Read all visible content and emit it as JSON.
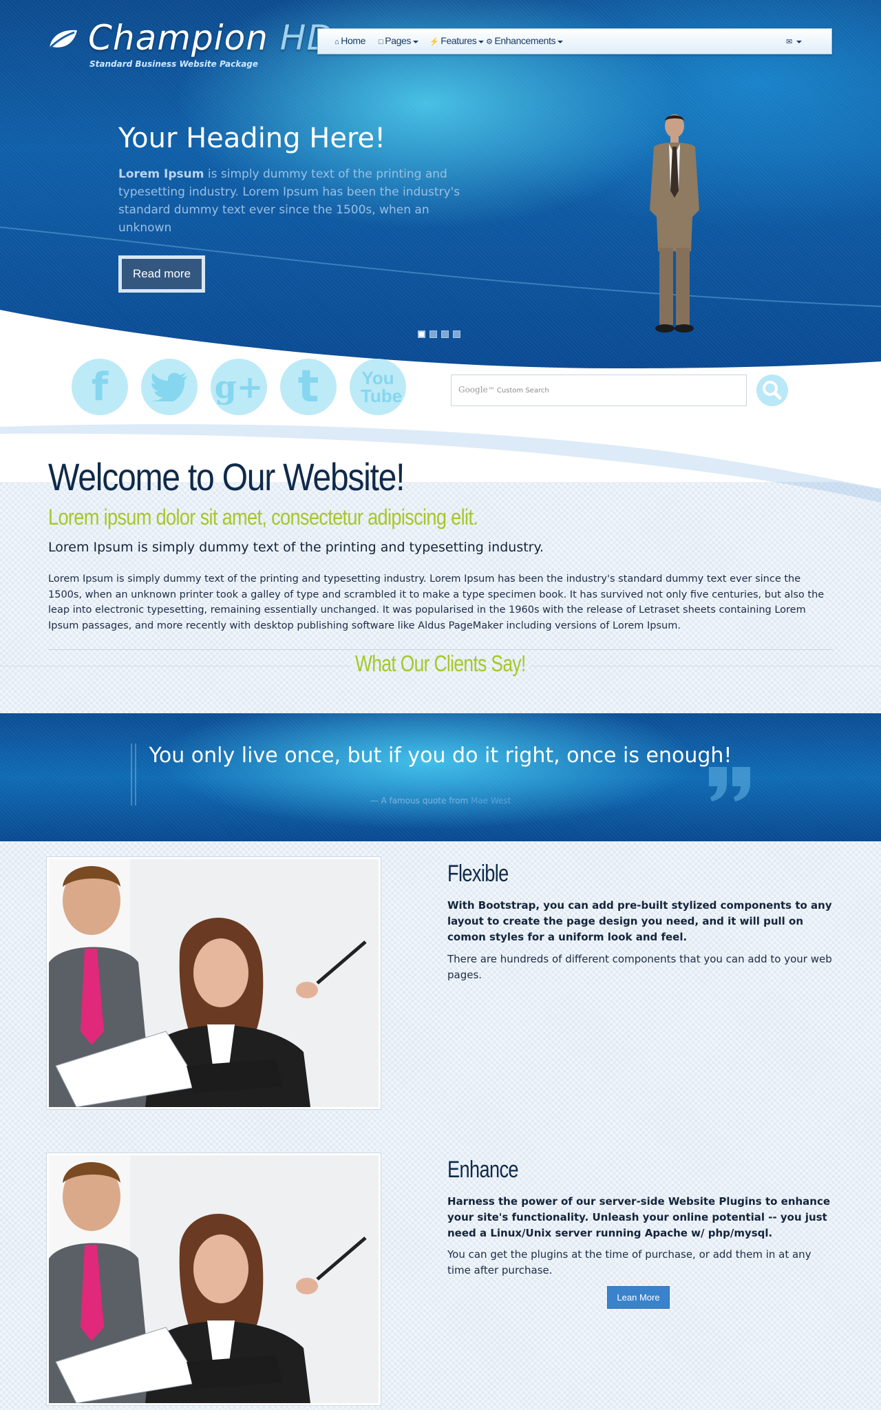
{
  "brand": {
    "title_main": "Champion",
    "title_accent": "HD",
    "tagline": "Standard Business Website Package"
  },
  "nav": {
    "items": [
      {
        "label": "Home",
        "icon": "home-icon",
        "dropdown": false
      },
      {
        "label": "Pages",
        "icon": "file-icon",
        "dropdown": true
      },
      {
        "label": "Features",
        "icon": "bolt-icon",
        "dropdown": true
      },
      {
        "label": "Enhancements",
        "icon": "gears-icon",
        "dropdown": true
      }
    ],
    "right_icon": "envelope-icon"
  },
  "hero": {
    "heading": "Your Heading Here!",
    "text_bold": "Lorem Ipsum",
    "text_rest": " is simply dummy text of the printing and typesetting industry. Lorem Ipsum has been the industry's standard dummy text ever since the 1500s, when an unknown",
    "button": "Read more",
    "slides": [
      true,
      false,
      false,
      false
    ]
  },
  "social": [
    "f",
    "t",
    "g+",
    "t",
    "You Tube"
  ],
  "search": {
    "logo": "Google",
    "placeholder": "Custom Search"
  },
  "welcome": {
    "title": "Welcome to Our Website!",
    "subtitle": "Lorem ipsum dolor sit amet, consectetur adipiscing elit.",
    "lead": "Lorem Ipsum is simply dummy text of the printing and typesetting industry.",
    "body": "Lorem Ipsum is simply dummy text of the printing and typesetting industry. Lorem Ipsum has been the industry's standard dummy text ever since the 1500s, when an unknown printer took a galley of type and scrambled it to make a type specimen book. It has survived not only five centuries, but also the leap into electronic typesetting, remaining essentially unchanged. It was popularised in the 1960s with the release of Letraset sheets containing Lorem Ipsum passages, and more recently with desktop publishing software like Aldus PageMaker including versions of Lorem Ipsum."
  },
  "clients": {
    "title": "What Our Clients Say!"
  },
  "quote": {
    "text": "You only live once, but if you do it right, once is enough!",
    "cite_prefix": "— A famous quote from",
    "cite_author": "Mae West"
  },
  "features": [
    {
      "title": "Flexible",
      "bold": "With Bootstrap, you can add pre-built stylized components to any layout to create the page design you need, and it will pull on comon styles for a uniform look and feel.",
      "text": "There are hundreds of different components that you can add to your web pages."
    },
    {
      "title": "Enhance",
      "bold": "Harness the power of our server-side Website Plugins to enhance your site's functionality.  Unleash your online potential -- you just need a Linux/Unix server running Apache w/ php/mysql.",
      "text": "You can get the plugins at the time of purchase, or add them in at any time after purchase.",
      "button": "Lean More"
    }
  ],
  "colors": {
    "accent_green": "#a8c628",
    "navy": "#0f2a4a",
    "hero_blue": "#0f5fa8",
    "button_blue": "#3a83cc"
  }
}
